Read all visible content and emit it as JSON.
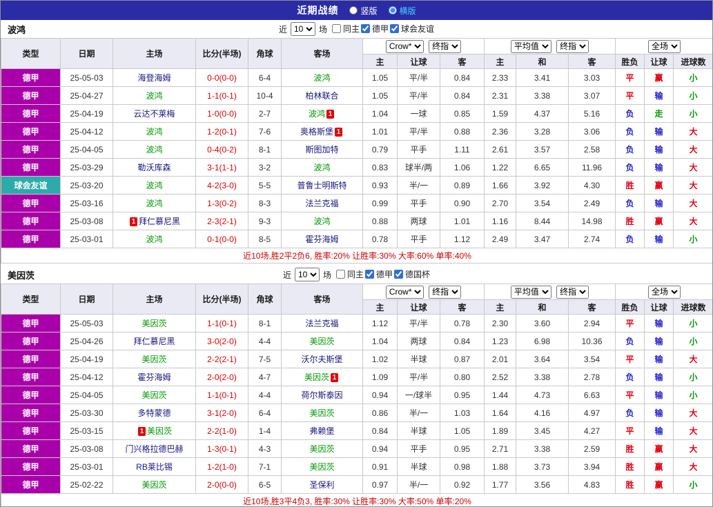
{
  "topbar": {
    "title": "近期战绩",
    "options": {
      "vertical": "竖版",
      "horizontal": "横版",
      "selected": "横版"
    }
  },
  "controls": {
    "near_label": "近",
    "games_count": "10",
    "games_label": "场"
  },
  "header": {
    "col_type": "类型",
    "col_date": "日期",
    "col_home": "主场",
    "col_score": "比分(半场)",
    "col_corner": "角球",
    "col_away": "客场",
    "select_bookmaker": "Crow*",
    "select_final": "终指",
    "select_average": "平均值",
    "select_fullmatch": "全场",
    "sub": [
      "主",
      "让球",
      "客",
      "主",
      "和",
      "客",
      "胜负",
      "让球",
      "进球数"
    ]
  },
  "colors": {
    "league": {
      "德甲": "#aa00aa",
      "球会友谊": "#2faaaa"
    },
    "result": {
      "胜": "#e60012",
      "平": "#e60012",
      "负": "#2323cd",
      "赢": "#e60012",
      "输": "#2323cd",
      "走": "#009900",
      "大": "#e60012",
      "小": "#009900"
    },
    "subject_team": "#009900",
    "opponent_team": "#17177f",
    "score": "#dd0000",
    "summary": "#cc0000"
  },
  "sections": [
    {
      "team": "波鸿",
      "filters": [
        {
          "label": "同主",
          "checked": false
        },
        {
          "label": "德甲",
          "checked": true
        },
        {
          "label": "球会友谊",
          "checked": true
        }
      ],
      "rows": [
        {
          "league": "德甲",
          "date": "25-05-03",
          "home": "海登海姆",
          "home_card": "",
          "score": "0-0(0-0)",
          "corner": "6-4",
          "away": "波鸿",
          "away_card": "",
          "odds": [
            "1.05",
            "平/半",
            "0.84"
          ],
          "euro": [
            "2.33",
            "3.41",
            "3.03"
          ],
          "results": [
            "平",
            "赢",
            "小"
          ]
        },
        {
          "league": "德甲",
          "date": "25-04-27",
          "home": "波鸿",
          "home_card": "",
          "score": "1-1(0-1)",
          "corner": "10-4",
          "away": "柏林联合",
          "away_card": "",
          "odds": [
            "1.05",
            "平/半",
            "0.84"
          ],
          "euro": [
            "2.31",
            "3.38",
            "3.07"
          ],
          "results": [
            "平",
            "输",
            "小"
          ]
        },
        {
          "league": "德甲",
          "date": "25-04-19",
          "home": "云达不莱梅",
          "home_card": "",
          "score": "1-0(0-0)",
          "corner": "2-7",
          "away": "波鸿",
          "away_card": "1",
          "odds": [
            "1.04",
            "一球",
            "0.85"
          ],
          "euro": [
            "1.59",
            "4.37",
            "5.16"
          ],
          "results": [
            "负",
            "走",
            "小"
          ]
        },
        {
          "league": "德甲",
          "date": "25-04-12",
          "home": "波鸿",
          "home_card": "",
          "score": "1-2(0-1)",
          "corner": "7-6",
          "away": "奥格斯堡",
          "away_card": "1",
          "odds": [
            "1.01",
            "平/半",
            "0.88"
          ],
          "euro": [
            "2.36",
            "3.28",
            "3.06"
          ],
          "results": [
            "负",
            "输",
            "大"
          ]
        },
        {
          "league": "德甲",
          "date": "25-04-05",
          "home": "波鸿",
          "home_card": "",
          "score": "0-4(0-2)",
          "corner": "8-1",
          "away": "斯图加特",
          "away_card": "",
          "odds": [
            "0.79",
            "平手",
            "1.11"
          ],
          "euro": [
            "2.61",
            "3.57",
            "2.58"
          ],
          "results": [
            "负",
            "输",
            "大"
          ]
        },
        {
          "league": "德甲",
          "date": "25-03-29",
          "home": "勒沃库森",
          "home_card": "",
          "score": "3-1(1-1)",
          "corner": "3-2",
          "away": "波鸿",
          "away_card": "",
          "odds": [
            "0.83",
            "球半/两",
            "1.06"
          ],
          "euro": [
            "1.22",
            "6.65",
            "11.96"
          ],
          "results": [
            "负",
            "输",
            "大"
          ]
        },
        {
          "league": "球会友谊",
          "date": "25-03-20",
          "home": "波鸿",
          "home_card": "",
          "score": "4-2(3-0)",
          "corner": "5-5",
          "away": "普鲁士明斯特",
          "away_card": "",
          "odds": [
            "0.93",
            "半/一",
            "0.89"
          ],
          "euro": [
            "1.66",
            "3.92",
            "4.30"
          ],
          "results": [
            "胜",
            "赢",
            "大"
          ]
        },
        {
          "league": "德甲",
          "date": "25-03-16",
          "home": "波鸿",
          "home_card": "",
          "score": "1-3(0-2)",
          "corner": "8-3",
          "away": "法兰克福",
          "away_card": "",
          "odds": [
            "0.99",
            "平手",
            "0.90"
          ],
          "euro": [
            "2.70",
            "3.54",
            "2.49"
          ],
          "results": [
            "负",
            "输",
            "大"
          ]
        },
        {
          "league": "德甲",
          "date": "25-03-08",
          "home": "拜仁慕尼黑",
          "home_card": "1",
          "score": "2-3(2-1)",
          "corner": "9-3",
          "away": "波鸿",
          "away_card": "",
          "odds": [
            "0.88",
            "两球",
            "1.01"
          ],
          "euro": [
            "1.16",
            "8.44",
            "14.98"
          ],
          "results": [
            "胜",
            "赢",
            "大"
          ]
        },
        {
          "league": "德甲",
          "date": "25-03-01",
          "home": "波鸿",
          "home_card": "",
          "score": "0-1(0-0)",
          "corner": "8-5",
          "away": "霍芬海姆",
          "away_card": "",
          "odds": [
            "0.78",
            "平手",
            "1.12"
          ],
          "euro": [
            "2.49",
            "3.47",
            "2.74"
          ],
          "results": [
            "负",
            "输",
            "小"
          ]
        }
      ],
      "summary": "近10场,胜2平2负6, 胜率:20% 让胜率:30% 大率:60% 单率:40%"
    },
    {
      "team": "美因茨",
      "filters": [
        {
          "label": "同主",
          "checked": false
        },
        {
          "label": "德甲",
          "checked": true
        },
        {
          "label": "德国杯",
          "checked": true
        }
      ],
      "rows": [
        {
          "league": "德甲",
          "date": "25-05-03",
          "home": "美因茨",
          "home_card": "",
          "score": "1-1(0-1)",
          "corner": "8-1",
          "away": "法兰克福",
          "away_card": "",
          "odds": [
            "1.12",
            "平/半",
            "0.78"
          ],
          "euro": [
            "2.30",
            "3.60",
            "2.94"
          ],
          "results": [
            "平",
            "输",
            "小"
          ]
        },
        {
          "league": "德甲",
          "date": "25-04-26",
          "home": "拜仁慕尼黑",
          "home_card": "",
          "score": "3-0(2-0)",
          "corner": "4-4",
          "away": "美因茨",
          "away_card": "",
          "odds": [
            "1.04",
            "两球",
            "0.84"
          ],
          "euro": [
            "1.23",
            "6.98",
            "10.36"
          ],
          "results": [
            "负",
            "输",
            "小"
          ]
        },
        {
          "league": "德甲",
          "date": "25-04-19",
          "home": "美因茨",
          "home_card": "",
          "score": "2-2(2-1)",
          "corner": "7-5",
          "away": "沃尔夫斯堡",
          "away_card": "",
          "odds": [
            "1.02",
            "半球",
            "0.87"
          ],
          "euro": [
            "2.01",
            "3.64",
            "3.54"
          ],
          "results": [
            "平",
            "输",
            "大"
          ]
        },
        {
          "league": "德甲",
          "date": "25-04-12",
          "home": "霍芬海姆",
          "home_card": "",
          "score": "2-0(2-0)",
          "corner": "4-7",
          "away": "美因茨",
          "away_card": "1",
          "odds": [
            "1.09",
            "平/半",
            "0.80"
          ],
          "euro": [
            "2.52",
            "3.38",
            "2.78"
          ],
          "results": [
            "负",
            "输",
            "小"
          ]
        },
        {
          "league": "德甲",
          "date": "25-04-05",
          "home": "美因茨",
          "home_card": "",
          "score": "1-1(0-1)",
          "corner": "4-4",
          "away": "荷尔斯泰因",
          "away_card": "",
          "odds": [
            "0.94",
            "一/球半",
            "0.95"
          ],
          "euro": [
            "1.44",
            "4.73",
            "6.63"
          ],
          "results": [
            "平",
            "输",
            "小"
          ]
        },
        {
          "league": "德甲",
          "date": "25-03-30",
          "home": "多特蒙德",
          "home_card": "",
          "score": "3-1(2-0)",
          "corner": "6-4",
          "away": "美因茨",
          "away_card": "",
          "odds": [
            "0.86",
            "半/一",
            "1.03"
          ],
          "euro": [
            "1.64",
            "4.16",
            "4.97"
          ],
          "results": [
            "负",
            "输",
            "大"
          ]
        },
        {
          "league": "德甲",
          "date": "25-03-15",
          "home": "美因茨",
          "home_card": "1",
          "score": "2-2(1-0)",
          "corner": "1-4",
          "away": "弗赖堡",
          "away_card": "",
          "odds": [
            "0.84",
            "半球",
            "1.05"
          ],
          "euro": [
            "1.89",
            "3.45",
            "4.27"
          ],
          "results": [
            "平",
            "输",
            "大"
          ]
        },
        {
          "league": "德甲",
          "date": "25-03-08",
          "home": "门兴格拉德巴赫",
          "home_card": "",
          "score": "1-3(0-1)",
          "corner": "4-3",
          "away": "美因茨",
          "away_card": "",
          "odds": [
            "0.94",
            "平手",
            "0.95"
          ],
          "euro": [
            "2.71",
            "3.38",
            "2.59"
          ],
          "results": [
            "胜",
            "赢",
            "大"
          ]
        },
        {
          "league": "德甲",
          "date": "25-03-01",
          "home": "RB莱比锡",
          "home_card": "",
          "score": "1-2(1-0)",
          "corner": "7-1",
          "away": "美因茨",
          "away_card": "",
          "odds": [
            "0.91",
            "半球",
            "0.98"
          ],
          "euro": [
            "1.88",
            "3.73",
            "3.94"
          ],
          "results": [
            "胜",
            "赢",
            "大"
          ]
        },
        {
          "league": "德甲",
          "date": "25-02-22",
          "home": "美因茨",
          "home_card": "",
          "score": "2-0(0-0)",
          "corner": "6-5",
          "away": "圣保利",
          "away_card": "",
          "odds": [
            "0.97",
            "半/一",
            "0.92"
          ],
          "euro": [
            "1.77",
            "3.56",
            "4.83"
          ],
          "results": [
            "胜",
            "赢",
            "小"
          ]
        }
      ],
      "summary": "近10场,胜3平4负3, 胜率:30% 让胜率:30% 大率:50% 单率:20%"
    }
  ]
}
